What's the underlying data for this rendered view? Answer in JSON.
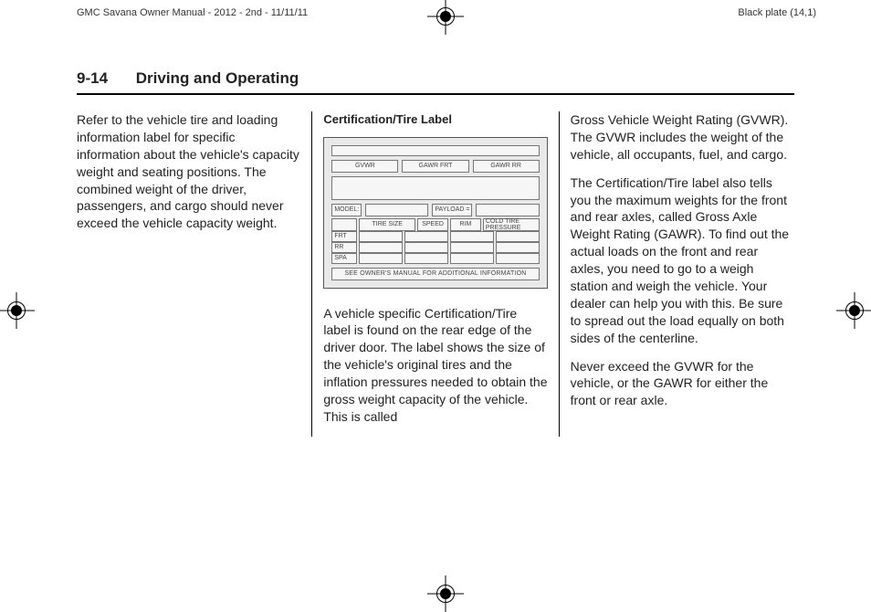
{
  "meta": {
    "left": "GMC Savana Owner Manual - 2012 - 2nd - 11/11/11",
    "right": "Black plate (14,1)"
  },
  "header": {
    "page_number": "9-14",
    "section_title": "Driving and Operating"
  },
  "col1": {
    "p1": "Refer to the vehicle tire and loading information label for specific information about the vehicle's capacity weight and seating positions. The combined weight of the driver, passengers, and cargo should never exceed the vehicle capacity weight."
  },
  "col2": {
    "subhead": "Certification/Tire Label",
    "label_diagram": {
      "gvwr": "GVWR",
      "gawr_frt": "GAWR FRT",
      "gawr_rr": "GAWR RR",
      "model": "MODEL:",
      "payload": "PAYLOAD =",
      "tire_size": "TIRE SIZE",
      "speed": "SPEED",
      "rim": "RIM",
      "cold_pressure": "COLD TIRE PRESSURE",
      "rows": [
        "FRT",
        "RR",
        "SPA"
      ],
      "footer": "SEE OWNER'S MANUAL FOR ADDITIONAL INFORMATION"
    },
    "p1": "A vehicle specific Certification/Tire label is found on the rear edge of the driver door. The label shows the size of the vehicle's original tires and the inflation pressures needed to obtain the gross weight capacity of the vehicle. This is called"
  },
  "col3": {
    "p1": "Gross Vehicle Weight Rating (GVWR). The GVWR includes the weight of the vehicle, all occupants, fuel, and cargo.",
    "p2": "The Certification/Tire label also tells you the maximum weights for the front and rear axles, called Gross Axle Weight Rating (GAWR). To find out the actual loads on the front and rear axles, you need to go to a weigh station and weigh the vehicle. Your dealer can help you with this. Be sure to spread out the load equally on both sides of the centerline.",
    "p3": "Never exceed the GVWR for the vehicle, or the GAWR for either the front or rear axle."
  }
}
